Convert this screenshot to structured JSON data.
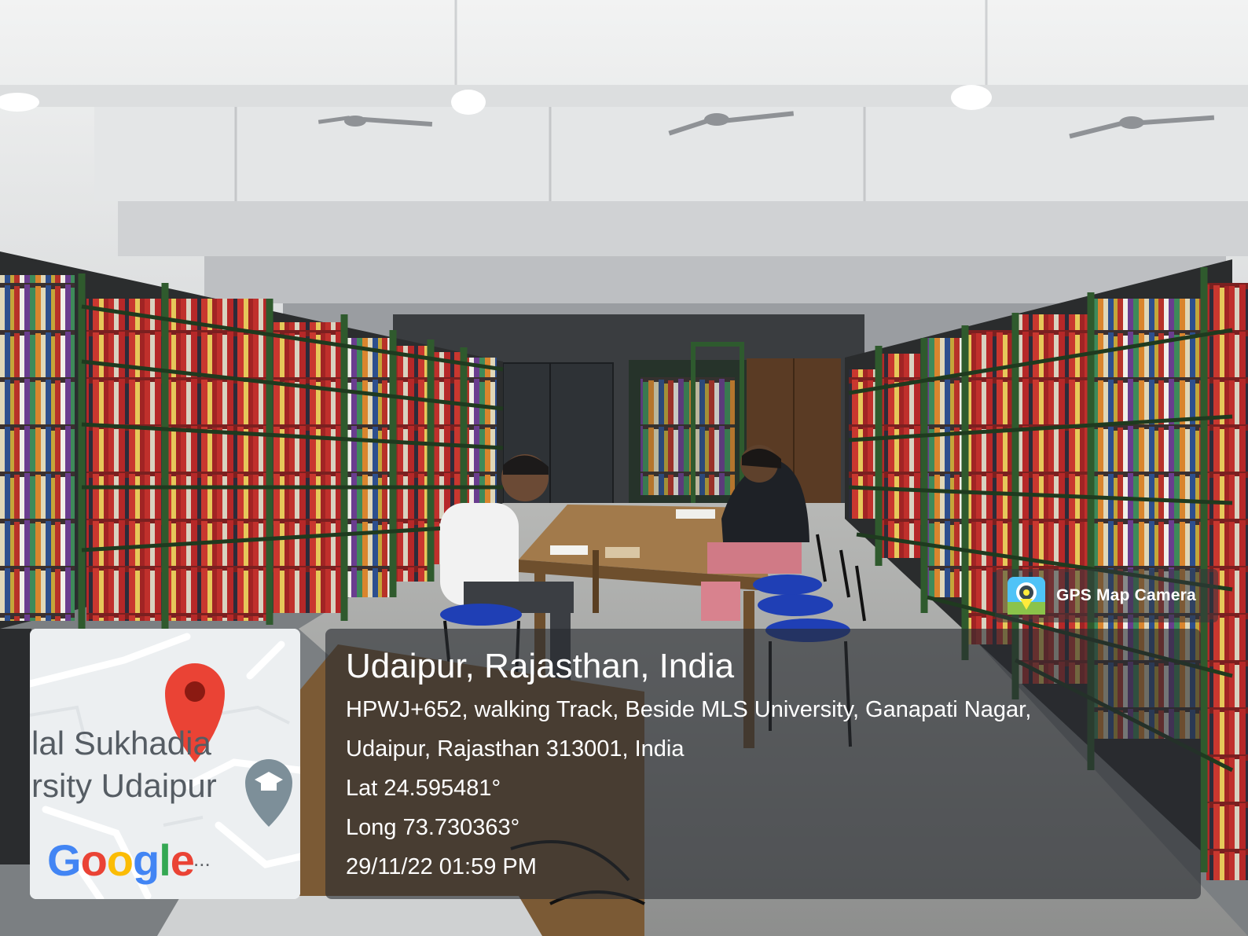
{
  "location": {
    "city_line": "Udaipur, Rajasthan, India",
    "address_line_1": "HPWJ+652, walking Track, Beside MLS University, Ganapati Nagar,",
    "address_line_2": "Udaipur, Rajasthan 313001, India",
    "latitude": "Lat 24.595481°",
    "longitude": "Long 73.730363°",
    "timestamp": "29/11/22 01:59 PM"
  },
  "badge": {
    "label": "GPS Map Camera",
    "icon": "gps-map-camera-icon"
  },
  "map": {
    "label_line_1": "lal Sukhadia",
    "label_line_2": "rsity Udaipur",
    "logo_letters": [
      "G",
      "o",
      "o",
      "g",
      "l",
      "e"
    ],
    "logo_colors": [
      "#4285F4",
      "#EA4335",
      "#FBBC05",
      "#4285F4",
      "#34A853",
      "#EA4335"
    ],
    "ellipsis": "...",
    "pin_color": "#EA4335",
    "pin_icon": "map-pin-icon",
    "poi_icon": "graduation-cap-icon"
  },
  "colors": {
    "shelf_green": "#2c4a2a",
    "book_red": "#b92a2a",
    "table_wood": "#9a7446",
    "chair_blue": "#1f3fb5"
  }
}
